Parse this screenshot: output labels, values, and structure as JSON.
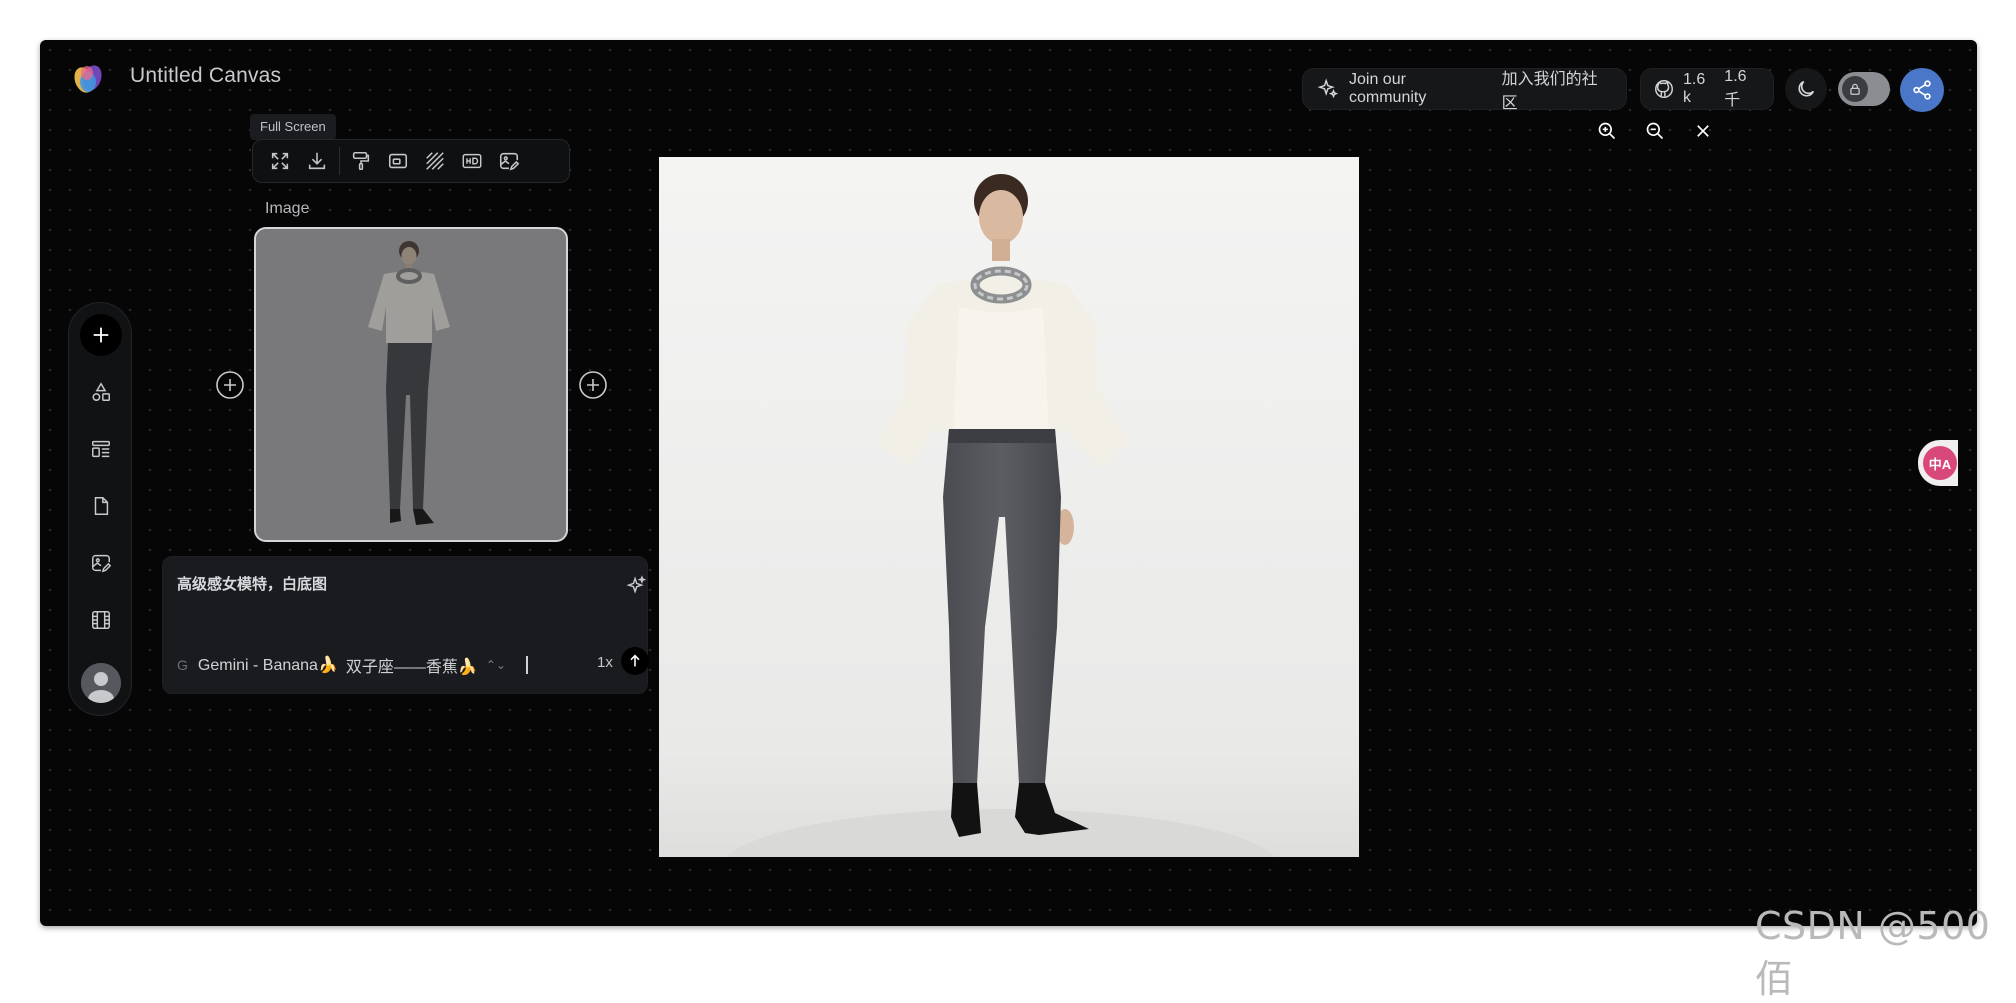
{
  "header": {
    "canvas_title": "Untitled Canvas",
    "community_label": "Join our community",
    "community_label_cn": "加入我们的社区",
    "stars_count": "1.6 k",
    "stars_count_cn": "1.6千"
  },
  "toolbar": {
    "tooltip": "Full Screen",
    "icons": [
      "fullscreen-icon",
      "download-icon",
      "paint-roller-icon",
      "crop-icon",
      "hatch-icon",
      "hd-icon",
      "image-edit-icon"
    ]
  },
  "node": {
    "label": "Image"
  },
  "rail": {
    "items": [
      "add-icon",
      "shapes-icon",
      "layout-icon",
      "document-icon",
      "image-edit-icon",
      "film-icon",
      "avatar"
    ]
  },
  "prompt": {
    "text": "高级感女模特，白底图",
    "model_prefix": "G",
    "model_name": "Gemini - Banana🍌",
    "model_variant": "双子座——香蕉🍌",
    "multiplier": "1x"
  },
  "translate": {
    "label": "中A"
  },
  "watermark": "CSDN @500佰",
  "colors": {
    "canvas_bg": "#060607",
    "accent_share": "#4b77c8",
    "translate_badge": "#d9487a"
  }
}
